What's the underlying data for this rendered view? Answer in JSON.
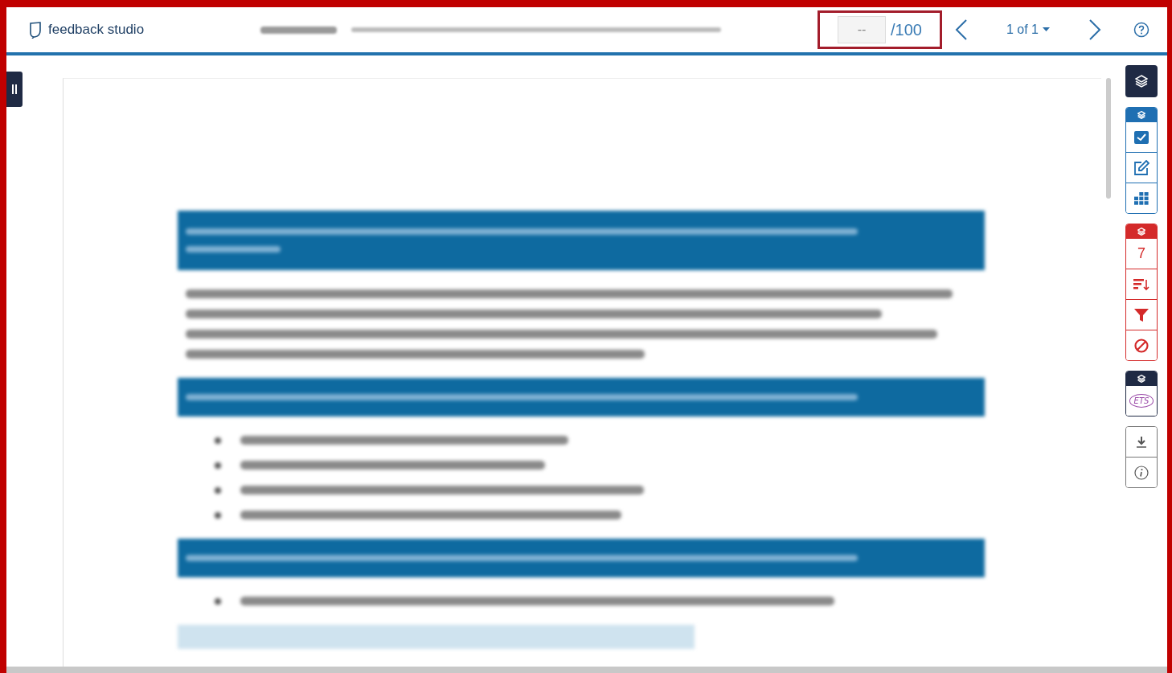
{
  "app": {
    "name": "feedback studio"
  },
  "score": {
    "placeholder": "--",
    "max": "/100",
    "highlighted": true
  },
  "pager": {
    "label": "1 of 1"
  },
  "toolbar": {
    "top": {
      "kind": "layers",
      "selected": true
    },
    "groups": [
      {
        "color": "#1f6fb2",
        "kind": "headed",
        "items": [
          {
            "kind": "check"
          },
          {
            "kind": "edit"
          },
          {
            "kind": "grid"
          }
        ]
      },
      {
        "color": "#d42a2a",
        "kind": "headed",
        "items": [
          {
            "kind": "count",
            "text": "7"
          },
          {
            "kind": "sort"
          },
          {
            "kind": "filter"
          },
          {
            "kind": "block"
          }
        ]
      },
      {
        "color": "#1f2a44",
        "kind": "headed",
        "items": [
          {
            "kind": "badge",
            "text": "ETS"
          }
        ]
      },
      {
        "color": "#777777",
        "items": [
          {
            "kind": "download"
          },
          {
            "kind": "info"
          }
        ],
        "kind": "plain"
      }
    ]
  }
}
